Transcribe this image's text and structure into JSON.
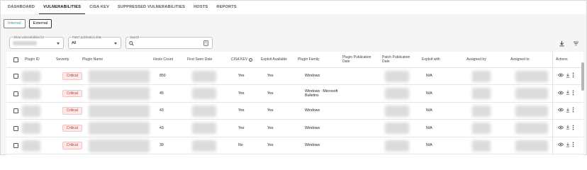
{
  "nav": {
    "tabs": [
      "DASHBOARD",
      "VULNERABILITIES",
      "CISA KEV",
      "SUPPRESSED VULNERABILITIES",
      "HOSTS",
      "REPORTS"
    ],
    "active": "VULNERABILITIES"
  },
  "toggle": {
    "internal": "Internal",
    "external": "External",
    "active": "Internal"
  },
  "filters": {
    "show_for_label": "Show vulnerabilities for",
    "patch_label": "Patch publication date",
    "patch_value": "All",
    "search_label": "Search"
  },
  "table": {
    "headers": {
      "plugin_id": "Plugin ID",
      "severity": "Severity",
      "plugin_name": "Plugin Name",
      "hosts_count": "Hosts Count",
      "first_seen": "First Seen Date",
      "cisa_kev": "CISA KEV",
      "exploit_available": "Exploit Available",
      "plugin_family": "Plugin Family",
      "plugin_pub": "Plugin Publication Date",
      "patch_pub": "Patch Publication Date",
      "exploit_with": "Exploit with",
      "assigned_by": "Assigned by",
      "assigned_to": "Assigned to",
      "actions": "Actions"
    },
    "rows": [
      {
        "severity": "Critical",
        "hosts": "850",
        "kev": "Yes",
        "exploit": "Yes",
        "family": "Windows",
        "exploit_with": "N/A"
      },
      {
        "severity": "Critical",
        "hosts": "45",
        "kev": "Yes",
        "exploit": "Yes",
        "family": "Windows : Microsoft Bulletins",
        "exploit_with": "N/A"
      },
      {
        "severity": "Critical",
        "hosts": "43",
        "kev": "Yes",
        "exploit": "Yes",
        "family": "Windows",
        "exploit_with": "N/A"
      },
      {
        "severity": "Critical",
        "hosts": "43",
        "kev": "Yes",
        "exploit": "Yes",
        "family": "Windows",
        "exploit_with": "N/A"
      },
      {
        "severity": "Critical",
        "hosts": "39",
        "kev": "No",
        "exploit": "Yes",
        "family": "Windows",
        "exploit_with": "N/A"
      }
    ]
  },
  "colors": {
    "accent": "#25a7a0",
    "critical_text": "#c0392b",
    "critical_bg": "#fbe9e9"
  },
  "icons": [
    "search-icon",
    "calculator-icon",
    "download-icon",
    "filter-icon",
    "info-icon",
    "eye-icon",
    "more-vert-icon"
  ]
}
